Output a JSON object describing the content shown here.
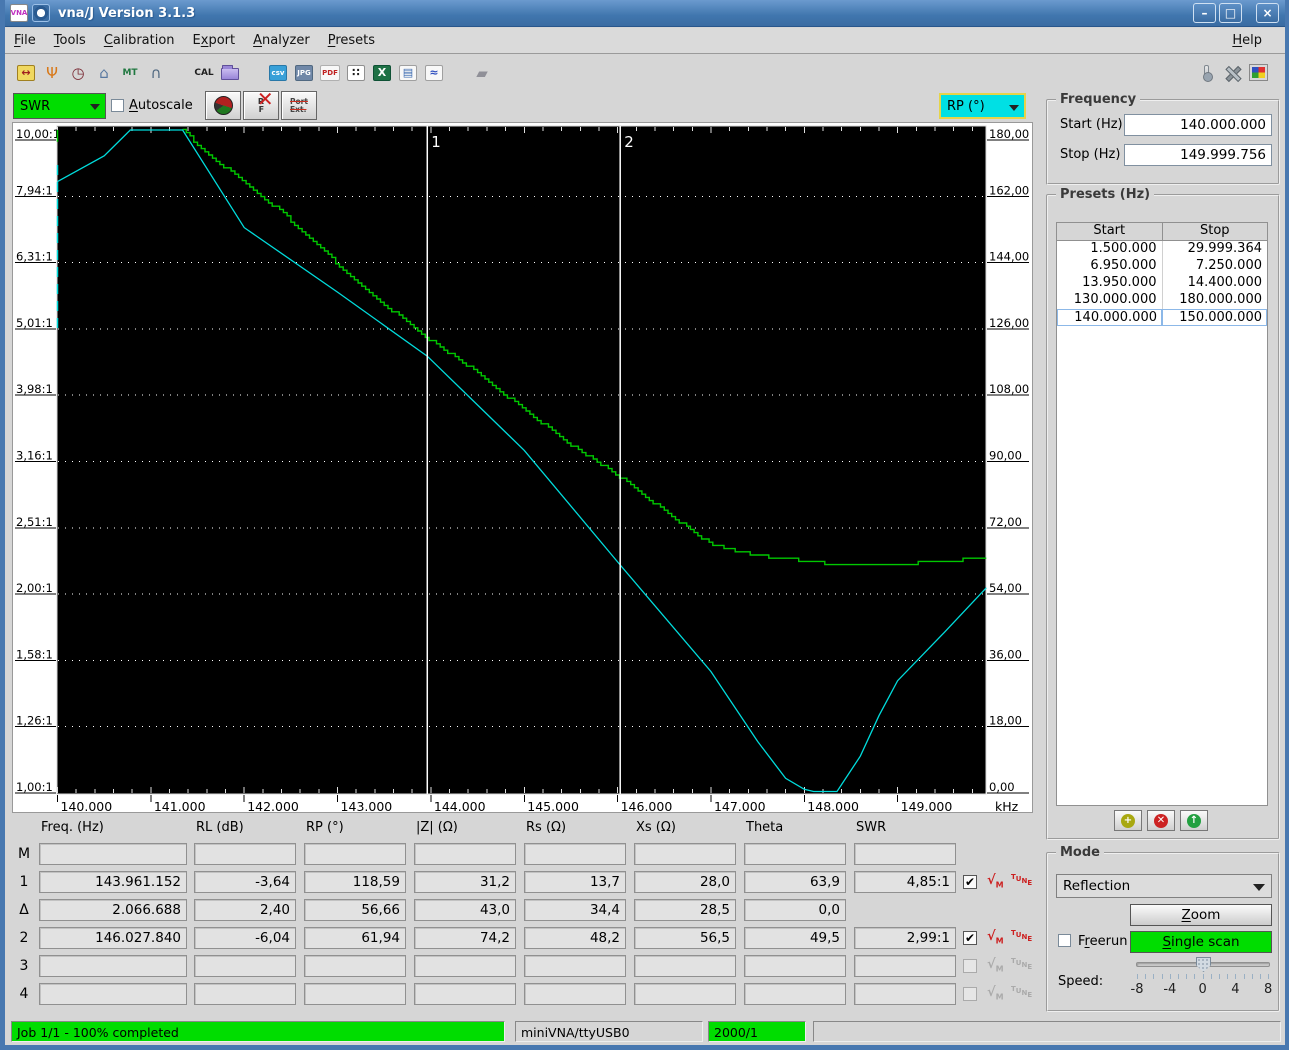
{
  "window": {
    "title": "vna/J Version 3.1.3",
    "buttons": {
      "minimize": "–",
      "maximize": "□",
      "close": "×"
    }
  },
  "menu": {
    "items": [
      {
        "label": "File",
        "mnemonic_index": 0
      },
      {
        "label": "Tools",
        "mnemonic_index": 0
      },
      {
        "label": "Calibration",
        "mnemonic_index": 0
      },
      {
        "label": "Export",
        "mnemonic_index": 1
      },
      {
        "label": "Analyzer",
        "mnemonic_index": 0
      },
      {
        "label": "Presets",
        "mnemonic_index": 0
      }
    ],
    "help": {
      "label": "Help",
      "mnemonic_index": 0
    }
  },
  "toolbar": {
    "left_groups": [
      [
        {
          "name": "wavelength-ruler-icon",
          "kind": "badge",
          "text": "↔",
          "fg": "#a02020",
          "bg": "#f0d860",
          "bd": "#a08020"
        },
        {
          "name": "antenna-icon",
          "kind": "glyph",
          "text": "Ψ",
          "fg": "#d87818"
        },
        {
          "name": "clock-gauge-icon",
          "kind": "glyph",
          "text": "◷",
          "fg": "#7a2a34"
        },
        {
          "name": "generator-icon",
          "kind": "glyph",
          "text": "⌂",
          "fg": "#5878a0"
        },
        {
          "name": "multi-tune-icon",
          "kind": "text",
          "text": "MT",
          "fg": "#207840"
        },
        {
          "name": "magnet-icon",
          "kind": "glyph",
          "text": "∩",
          "fg": "#506880"
        }
      ],
      [
        {
          "name": "calibration-cal-icon",
          "kind": "text",
          "text": "CAL",
          "fg": "#202020"
        },
        {
          "name": "open-folder-icon",
          "kind": "folder"
        }
      ],
      [
        {
          "name": "export-csv-icon",
          "kind": "badge",
          "text": "csv",
          "fg": "#ffffff",
          "bg": "#38a0d8",
          "bd": "#2878a8"
        },
        {
          "name": "export-jpg-icon",
          "kind": "badge",
          "text": "JPG",
          "fg": "#ffffff",
          "bg": "#7088a8",
          "bd": "#506880"
        },
        {
          "name": "export-pdf-icon",
          "kind": "badge",
          "text": "PDF",
          "fg": "#c02020",
          "bg": "#f8f8f8",
          "bd": "#b0b0b0"
        },
        {
          "name": "sample-points-icon",
          "kind": "badge",
          "text": "∷",
          "fg": "#202020",
          "bg": "#ffffff",
          "bd": "#909090"
        },
        {
          "name": "export-xls-icon",
          "kind": "badge",
          "text": "X",
          "fg": "#ffffff",
          "bg": "#1e7145",
          "bd": "#0e5135"
        },
        {
          "name": "report-icon",
          "kind": "badge",
          "text": "▤",
          "fg": "#3868b0",
          "bg": "#f8f8f8",
          "bd": "#a0a0a0"
        },
        {
          "name": "chart-export-icon",
          "kind": "badge",
          "text": "≈",
          "fg": "#3050c0",
          "bg": "#f8f8f8",
          "bd": "#a0a0a0"
        }
      ],
      [
        {
          "name": "eraser-icon",
          "kind": "glyph",
          "text": "▰",
          "fg": "#909098"
        }
      ]
    ],
    "right_group": [
      {
        "name": "thermometer-icon",
        "kind": "thermo"
      },
      {
        "name": "settings-tools-icon",
        "kind": "tools"
      },
      {
        "name": "color-palette-icon",
        "kind": "palette"
      }
    ]
  },
  "scale_bar": {
    "left_scale": {
      "label": "SWR",
      "color": "#00dd00"
    },
    "autoscale": {
      "label": "Autoscale",
      "mnemonic_index": 0,
      "checked": false
    },
    "buttons": [
      {
        "name": "smith-chart-button",
        "kind": "smith"
      },
      {
        "name": "reflection-loss-off-button",
        "kind": "crossrf",
        "letters": [
          "R",
          "F"
        ]
      },
      {
        "name": "port-extension-off-button",
        "kind": "portext",
        "lines": [
          "Port",
          "Ext."
        ]
      }
    ],
    "right_scale": {
      "label": "RP (°)",
      "color": "#00e0e4"
    }
  },
  "chart_data": {
    "type": "line",
    "x_axis": {
      "tick_labels": [
        "140.000",
        "141.000",
        "142.000",
        "143.000",
        "144.000",
        "145.000",
        "146.000",
        "147.000",
        "148.000",
        "149.000"
      ],
      "unit": "kHz",
      "start_mhz": 140.0,
      "stop_mhz": 149.95,
      "minors_per_major": 5
    },
    "left_axis": {
      "name": "SWR",
      "scale": "log",
      "min": 1.0,
      "max": 10.0,
      "tick_labels": [
        "10,00:1",
        "7,94:1",
        "6,31:1",
        "5,01:1",
        "3,98:1",
        "3,16:1",
        "2,51:1",
        "2,00:1",
        "1,58:1",
        "1,26:1",
        "1,00:1"
      ]
    },
    "right_axis": {
      "name": "RP (°)",
      "scale": "linear",
      "min": 0,
      "max": 180,
      "tick_labels": [
        "180,00",
        "162,00",
        "144,00",
        "126,00",
        "108,00",
        "90,00",
        "72,00",
        "54,00",
        "36,00",
        "18,00",
        "0,00"
      ]
    },
    "series": [
      {
        "name": "SWR",
        "color": "#00c800",
        "style": "step",
        "points": [
          [
            141.34,
            10.0
          ],
          [
            141.6,
            9.2
          ],
          [
            142.0,
            8.34
          ],
          [
            142.5,
            7.3
          ],
          [
            143.0,
            6.27
          ],
          [
            143.5,
            5.45
          ],
          [
            143.961,
            4.85
          ],
          [
            144.5,
            4.3
          ],
          [
            145.0,
            3.77
          ],
          [
            145.5,
            3.35
          ],
          [
            146.028,
            2.99
          ],
          [
            146.5,
            2.66
          ],
          [
            147.0,
            2.37
          ],
          [
            147.5,
            2.28
          ],
          [
            148.0,
            2.24
          ],
          [
            148.5,
            2.2
          ],
          [
            149.0,
            2.21
          ],
          [
            149.5,
            2.24
          ],
          [
            149.95,
            2.26
          ]
        ]
      },
      {
        "name": "RP",
        "color": "#00dcdc",
        "style": "line",
        "points": [
          [
            140.0,
            166
          ],
          [
            140.5,
            173
          ],
          [
            140.78,
            180
          ],
          [
            141.34,
            180
          ],
          [
            142.0,
            153.5
          ],
          [
            143.0,
            136
          ],
          [
            143.961,
            118.6
          ],
          [
            145.0,
            93
          ],
          [
            146.028,
            61.9
          ],
          [
            147.0,
            33
          ],
          [
            147.5,
            14
          ],
          [
            147.8,
            4
          ],
          [
            148.0,
            1
          ],
          [
            148.1,
            0.4
          ],
          [
            148.35,
            0.4
          ],
          [
            148.6,
            10
          ],
          [
            148.8,
            21
          ],
          [
            149.0,
            30.5
          ],
          [
            149.5,
            43.6
          ],
          [
            149.95,
            55.7
          ]
        ]
      }
    ],
    "left_edge_clipped_segments": [
      {
        "series": "SWR",
        "from": 10.0,
        "to": 9.6
      },
      {
        "series": "RP",
        "from": 170.5,
        "to": 125.0
      }
    ],
    "markers": [
      {
        "label": "1",
        "mhz": 143.961152
      },
      {
        "label": "2",
        "mhz": 146.02784
      }
    ],
    "grid": "dotted-horizontal"
  },
  "marker_table": {
    "columns": [
      "Freq. (Hz)",
      "RL (dB)",
      "RP (°)",
      "|Z| (Ω)",
      "Rs (Ω)",
      "Xs (Ω)",
      "Theta",
      "SWR"
    ],
    "rows": [
      {
        "label": "M",
        "values": [
          "",
          "",
          "",
          "",
          "",
          "",
          "",
          ""
        ],
        "checkbox": null,
        "icons": null
      },
      {
        "label": "1",
        "values": [
          "143.961.152",
          "-3,64",
          "118,59",
          "31,2",
          "13,7",
          "28,0",
          "63,9",
          "4,85:1"
        ],
        "checkbox": true,
        "icons": "active"
      },
      {
        "label": "Δ",
        "values": [
          "2.066.688",
          "2,40",
          "56,66",
          "43,0",
          "34,4",
          "28,5",
          "0,0",
          null
        ],
        "checkbox": null,
        "icons": null
      },
      {
        "label": "2",
        "values": [
          "146.027.840",
          "-6,04",
          "61,94",
          "74,2",
          "48,2",
          "56,5",
          "49,5",
          "2,99:1"
        ],
        "checkbox": true,
        "icons": "active"
      },
      {
        "label": "3",
        "values": [
          "",
          "",
          "",
          "",
          "",
          "",
          "",
          ""
        ],
        "checkbox": false,
        "icons": "inactive"
      },
      {
        "label": "4",
        "values": [
          "",
          "",
          "",
          "",
          "",
          "",
          "",
          ""
        ],
        "checkbox": false,
        "icons": "inactive"
      }
    ],
    "icon_glyphs": {
      "sqrt_marker": "√M",
      "tune": "TUNE"
    },
    "active_icon_color": "#cc2020",
    "inactive_icon_color": "#aaaaaa"
  },
  "frequency": {
    "title": "Frequency",
    "start_label": "Start (Hz)",
    "start_value": "140.000.000",
    "stop_label": "Stop (Hz)",
    "stop_value": "149.999.756"
  },
  "presets": {
    "title": "Presets (Hz)",
    "columns": [
      "Start",
      "Stop"
    ],
    "rows": [
      [
        "1.500.000",
        "29.999.364"
      ],
      [
        "6.950.000",
        "7.250.000"
      ],
      [
        "13.950.000",
        "14.400.000"
      ],
      [
        "130.000.000",
        "180.000.000"
      ],
      [
        "140.000.000",
        "150.000.000"
      ]
    ],
    "selected_index": 4,
    "buttons": [
      {
        "name": "preset-add-button",
        "glyph": "+",
        "color": "#a8a810"
      },
      {
        "name": "preset-delete-button",
        "glyph": "✕",
        "color": "#cc2222"
      },
      {
        "name": "preset-load-button",
        "glyph": "↑",
        "color": "#22a040"
      }
    ]
  },
  "mode": {
    "title": "Mode",
    "dropdown_value": "Reflection",
    "zoom_label": "Zoom",
    "zoom_mnemonic_index": 0,
    "freerun_label": "Freerun",
    "freerun_mnemonic_index": 1,
    "freerun_checked": false,
    "single_scan_label": "Single scan",
    "single_scan_mnemonic_index": 0,
    "single_scan_color": "#00dd00",
    "speed_label": "Speed:",
    "speed_tick_labels": [
      "-8",
      "-4",
      "0",
      "4",
      "8"
    ],
    "speed_min": -8,
    "speed_max": 8,
    "speed_value": 0
  },
  "status_bar": {
    "job": "Job 1/1 - 100% completed",
    "job_color": "#00dd00",
    "device": "miniVNA/ttyUSB0",
    "counter": "2000/1",
    "counter_color": "#00dd00",
    "extra": ""
  }
}
